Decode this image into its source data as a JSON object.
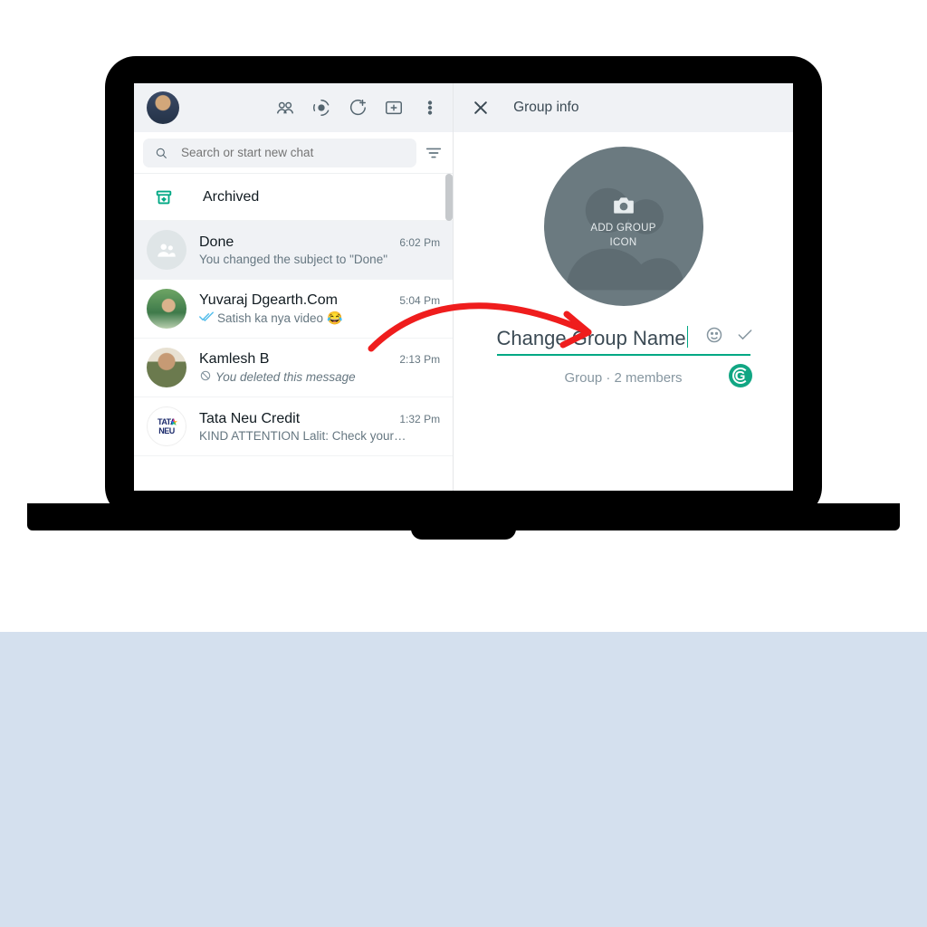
{
  "sidebar": {
    "search_placeholder": "Search or start new chat",
    "archived_label": "Archived",
    "chats": [
      {
        "name": "Done",
        "time": "6:02 Pm",
        "msg": "You changed the subject to \"Done\"",
        "ticks": false,
        "emoji": "",
        "deleted": false
      },
      {
        "name": "Yuvaraj Dgearth.Com",
        "time": "5:04 Pm",
        "msg": "Satish ka nya video ",
        "ticks": true,
        "emoji": "😂",
        "deleted": false
      },
      {
        "name": "Kamlesh B",
        "time": "2:13 Pm",
        "msg": "You deleted this message",
        "ticks": false,
        "emoji": "",
        "deleted": true
      },
      {
        "name": "Tata Neu Credit",
        "time": "1:32 Pm",
        "msg": "KIND ATTENTION Lalit: Check your…",
        "ticks": false,
        "emoji": "",
        "deleted": false
      }
    ]
  },
  "panel": {
    "title": "Group info",
    "add_icon_line1": "ADD GROUP",
    "add_icon_line2": "ICON",
    "name_value": "Change Group Name",
    "subline": "Group · 2 members"
  }
}
